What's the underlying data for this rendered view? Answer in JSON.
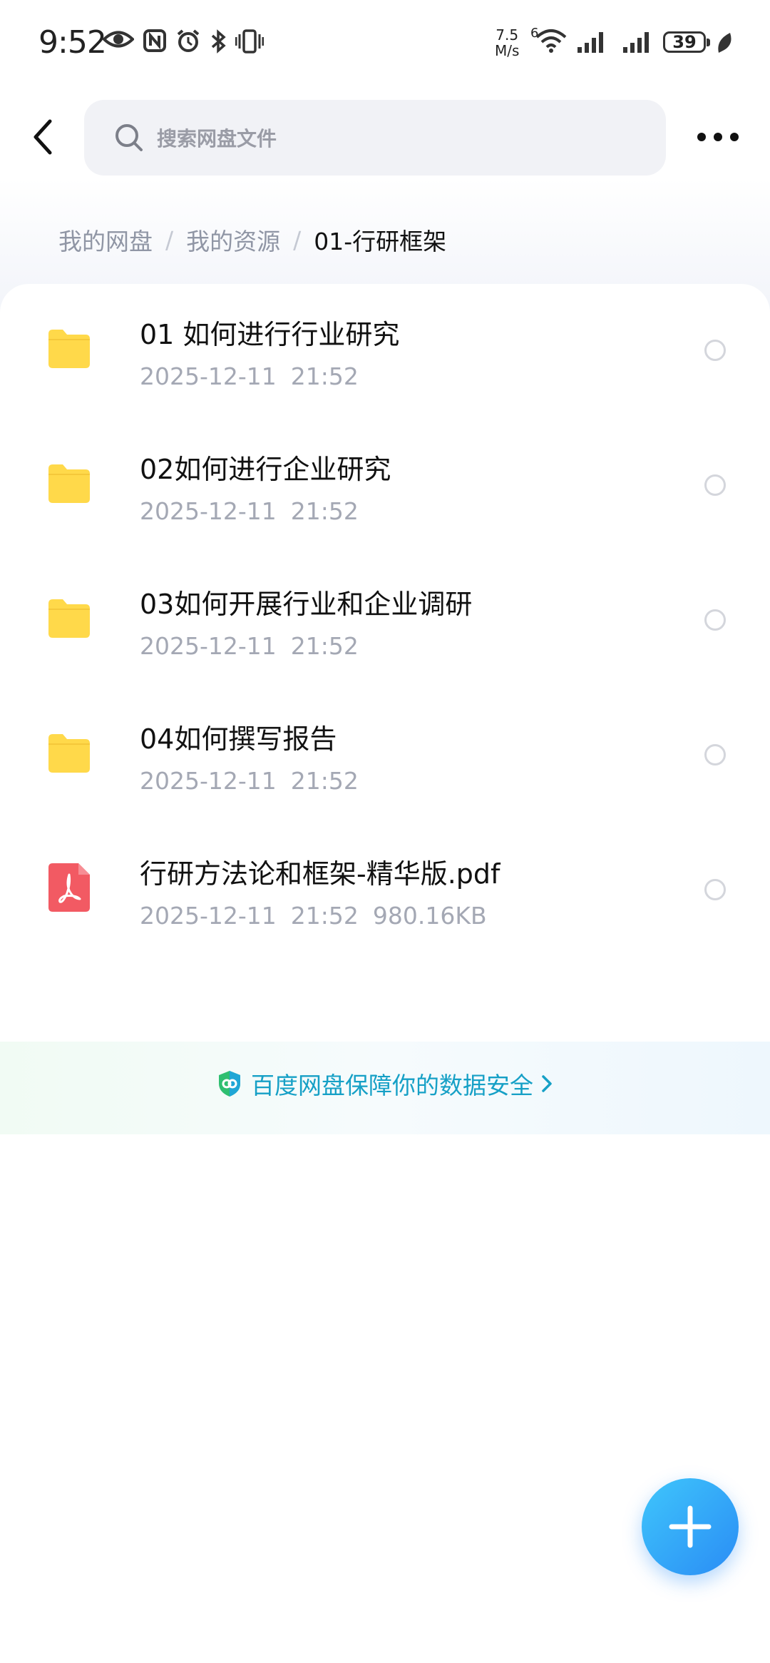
{
  "status_bar": {
    "time": "9:52",
    "net_speed_top": "7.5",
    "net_speed_bottom": "M/s",
    "wifi_tag": "6",
    "battery": "39",
    "icons": [
      "eye-icon",
      "nfc-icon",
      "alarm-icon",
      "bluetooth-icon",
      "vibrate-icon",
      "wifi-icon",
      "signal-icon",
      "signal-icon",
      "battery-icon",
      "leaf-icon"
    ]
  },
  "header": {
    "search_placeholder": "搜索网盘文件"
  },
  "breadcrumb": {
    "items": [
      "我的网盘",
      "我的资源",
      "01-行研框架"
    ],
    "separator": "/"
  },
  "files": [
    {
      "name": "01 如何进行行业研究",
      "date": "2025-12-11",
      "time": "21:52",
      "size": "",
      "type": "folder"
    },
    {
      "name": "02如何进行企业研究",
      "date": "2025-12-11",
      "time": "21:52",
      "size": "",
      "type": "folder"
    },
    {
      "name": "03如何开展行业和企业调研",
      "date": "2025-12-11",
      "time": "21:52",
      "size": "",
      "type": "folder"
    },
    {
      "name": "04如何撰写报告",
      "date": "2025-12-11",
      "time": "21:52",
      "size": "",
      "type": "folder"
    },
    {
      "name": "行研方法论和框架-精华版.pdf",
      "date": "2025-12-11",
      "time": "21:52",
      "size": "980.16KB",
      "type": "pdf"
    }
  ],
  "security": {
    "text": "百度网盘保障你的数据安全"
  },
  "colors": {
    "folder": "#ffd94a",
    "pdf": "#f25a63",
    "accent": "#16a0c6",
    "fab": "#2f9ef8"
  }
}
